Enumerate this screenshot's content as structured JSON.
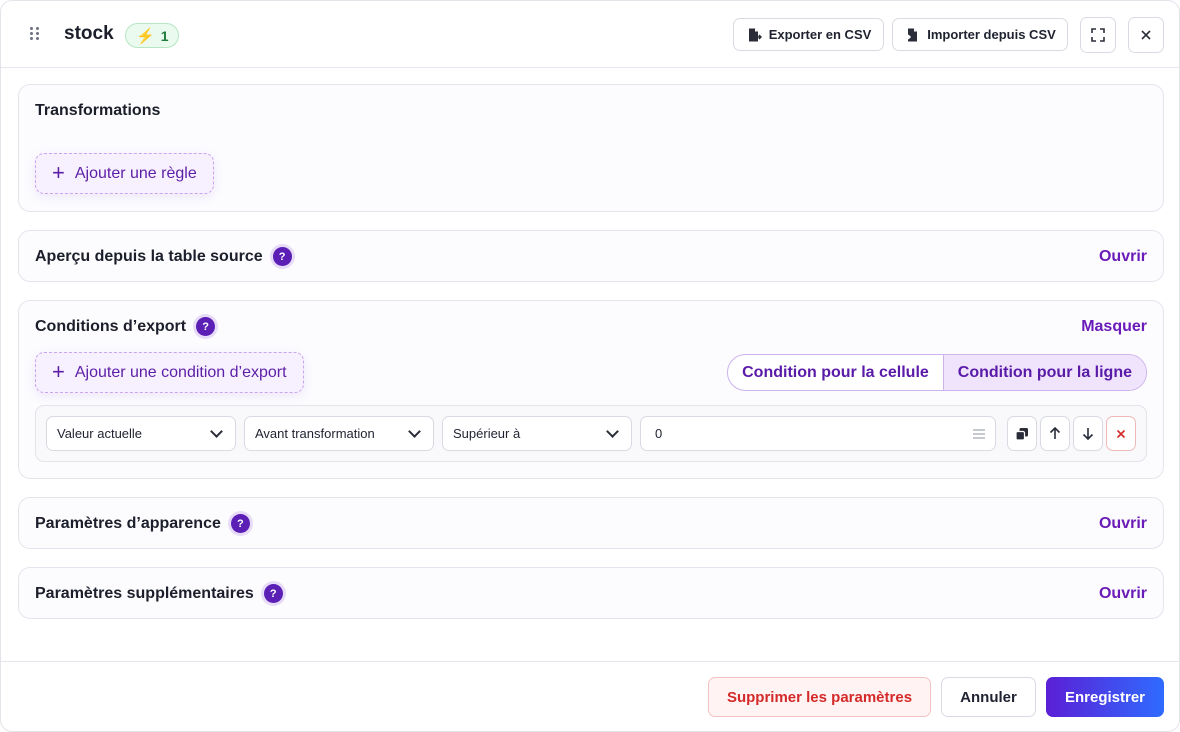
{
  "header": {
    "title": "stock",
    "badge_icon": "⚡",
    "badge_count": "1",
    "export_label": "Exporter en CSV",
    "import_label": "Importer depuis CSV"
  },
  "transformations": {
    "title": "Transformations",
    "add_rule_label": "Ajouter une règle"
  },
  "preview": {
    "title": "Aperçu depuis la table source",
    "toggle_label": "Ouvrir"
  },
  "conditions": {
    "title": "Conditions d’export",
    "toggle_label": "Masquer",
    "add_label": "Ajouter une condition d’export",
    "segment": {
      "cell_label": "Condition pour la cellule",
      "row_label": "Condition pour la ligne",
      "active": "row"
    },
    "row": {
      "field": "Valeur actuelle",
      "stage": "Avant transformation",
      "operator": "Supérieur à",
      "value": "0"
    }
  },
  "appearance": {
    "title": "Paramètres d’apparence",
    "toggle_label": "Ouvrir"
  },
  "extra": {
    "title": "Paramètres supplémentaires",
    "toggle_label": "Ouvrir"
  },
  "footer": {
    "delete_label": "Supprimer les paramètres",
    "cancel_label": "Annuler",
    "save_label": "Enregistrer"
  },
  "colors": {
    "accent": "#6a1bb8",
    "primary_gradient_start": "#5b1fd6",
    "primary_gradient_end": "#2f6bff",
    "danger": "#d42a2a",
    "success": "#1d7a3b"
  }
}
